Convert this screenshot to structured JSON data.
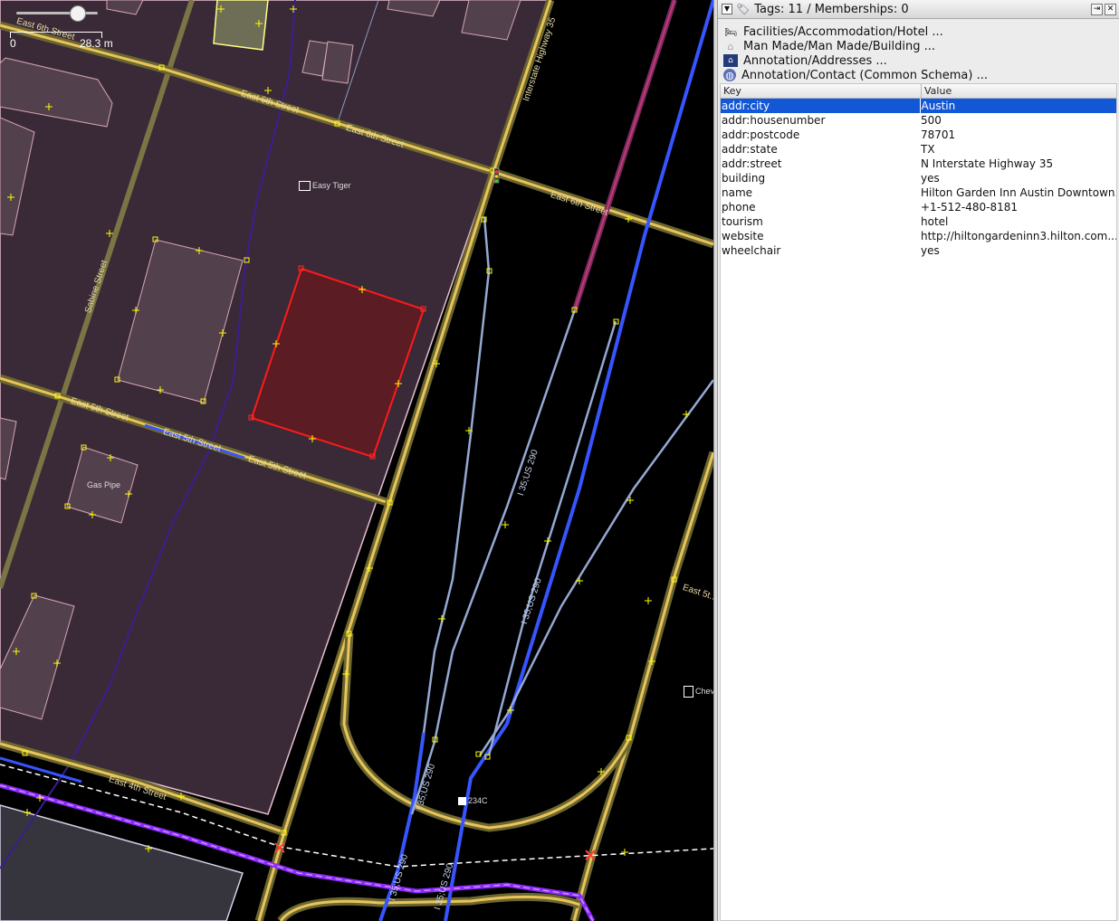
{
  "map": {
    "scale": {
      "zero_label": "0",
      "distance_label": "28.3 m"
    },
    "street_labels": {
      "e6_a": "East 6th Street",
      "e6_b": "East 6th Street",
      "e6_c": "East 6th Street",
      "e6_d": "East 6th Street",
      "e5_a": "East 5th Street",
      "e5_b": "East 5th Street",
      "e5_c": "East 5th Street",
      "e5_d": "East 5t...",
      "e4": "East 4th Street",
      "sabine": "Sabine Street",
      "i35": "Interstate Highway 35",
      "us290_a": "I 35;US 290",
      "us290_b": "I 35;US 290",
      "us290_c": "I 35;US 290",
      "us290_d": "I 35;US 290",
      "us290_e": "I 35;US 290"
    },
    "pois": {
      "easy_tiger": "Easy Tiger",
      "gas_pipe": "Gas Pipe",
      "exit": "234C",
      "chevron": "Chev"
    },
    "colors": {
      "block": "#3a2a37",
      "building": "#52404c",
      "building_stroke": "#d7a6b5",
      "selected_building": "#5c1c23",
      "selected_stroke": "#ff0000",
      "road_casing": "#6b6630",
      "road_core": "#e9c45a",
      "highway": "#3755ff",
      "ramp": "#95a9d3",
      "rail": "#8a2bff"
    }
  },
  "panel": {
    "title": "Tags: 11 / Memberships: 0",
    "presets": [
      {
        "icon": "bed-icon",
        "label": "Facilities/Accommodation/Hotel ..."
      },
      {
        "icon": "building-icon",
        "label": "Man Made/Man Made/Building ..."
      },
      {
        "icon": "address-icon",
        "label": "Annotation/Addresses ..."
      },
      {
        "icon": "globe-icon",
        "label": "Annotation/Contact (Common Schema) ..."
      }
    ],
    "table": {
      "key_header": "Key",
      "value_header": "Value",
      "rows": [
        {
          "key": "addr:city",
          "value": "Austin"
        },
        {
          "key": "addr:housenumber",
          "value": "500"
        },
        {
          "key": "addr:postcode",
          "value": "78701"
        },
        {
          "key": "addr:state",
          "value": "TX"
        },
        {
          "key": "addr:street",
          "value": "N Interstate Highway 35"
        },
        {
          "key": "building",
          "value": "yes"
        },
        {
          "key": "name",
          "value": "Hilton Garden Inn Austin Downtown..."
        },
        {
          "key": "phone",
          "value": "+1-512-480-8181"
        },
        {
          "key": "tourism",
          "value": "hotel"
        },
        {
          "key": "website",
          "value": "http://hiltongardeninn3.hilton.com..."
        },
        {
          "key": "wheelchair",
          "value": "yes"
        }
      ]
    }
  }
}
